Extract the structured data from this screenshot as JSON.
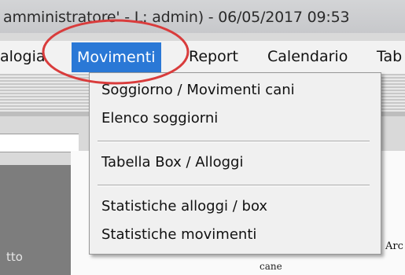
{
  "window": {
    "title": "amministratore' - L: admin) - 06/05/2017 09:53"
  },
  "menubar": {
    "items": [
      {
        "label": "alogia"
      },
      {
        "label": "Movimenti"
      },
      {
        "label": "Report"
      },
      {
        "label": "Calendario"
      },
      {
        "label": "Tab"
      }
    ],
    "active_index": 1
  },
  "dropdown": {
    "items": [
      {
        "label": "Soggiorno / Movimenti cani"
      },
      {
        "label": "Elenco soggiorni"
      },
      {
        "label": "Tabella Box / Alloggi"
      },
      {
        "label": "Statistiche alloggi / box"
      },
      {
        "label": "Statistiche movimenti"
      }
    ]
  },
  "left_panel": {
    "label": "tto"
  },
  "content": {
    "col_header_partial": "Arc",
    "col_header_sub": "cane"
  },
  "colors": {
    "menu_active_bg": "#2a78d6",
    "annotation_circle": "#d93c3c"
  }
}
